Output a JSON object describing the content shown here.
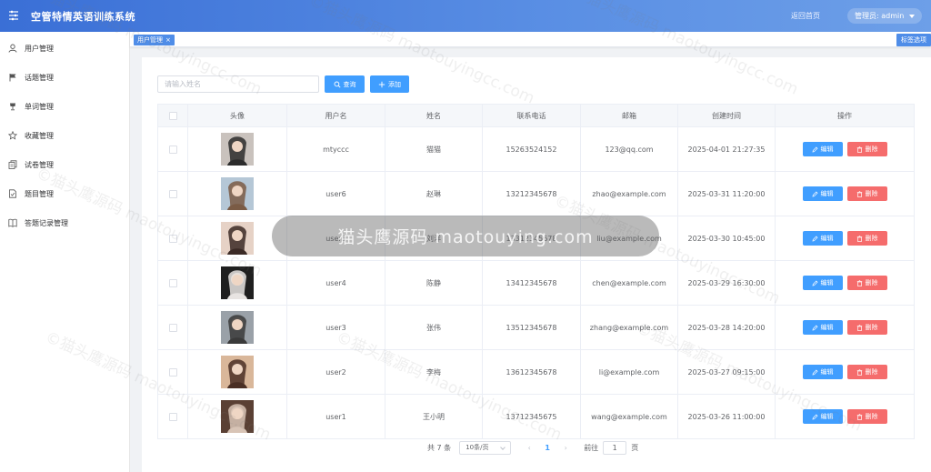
{
  "header": {
    "title": "空管特情英语训练系统",
    "return_home": "返回首页",
    "user_label": "管理员: admin"
  },
  "sidebar": {
    "items": [
      {
        "label": "用户管理",
        "icon": "user-icon"
      },
      {
        "label": "话题管理",
        "icon": "flag-icon"
      },
      {
        "label": "单词管理",
        "icon": "cup-icon"
      },
      {
        "label": "收藏管理",
        "icon": "star-icon"
      },
      {
        "label": "试卷管理",
        "icon": "document-copy-icon"
      },
      {
        "label": "题目管理",
        "icon": "document-checked-icon"
      },
      {
        "label": "答题记录管理",
        "icon": "notebook-icon"
      }
    ]
  },
  "tabs": {
    "active": "用户管理",
    "options_label": "标签选项"
  },
  "toolbar": {
    "search_placeholder": "请输入姓名",
    "query_label": "查询",
    "add_label": "添加"
  },
  "table": {
    "headers": [
      "头像",
      "用户名",
      "姓名",
      "联系电话",
      "邮箱",
      "创建时间",
      "操作"
    ],
    "edit_label": "编辑",
    "delete_label": "删除",
    "rows": [
      {
        "username": "mtyccc",
        "name": "猫猫",
        "phone": "15263524152",
        "email": "123@qq.com",
        "created": "2025-04-01 21:27:35"
      },
      {
        "username": "user6",
        "name": "赵琳",
        "phone": "13212345678",
        "email": "zhao@example.com",
        "created": "2025-03-31 11:20:00"
      },
      {
        "username": "user5",
        "name": "刘洋",
        "phone": "13312345678",
        "email": "liu@example.com",
        "created": "2025-03-30 10:45:00"
      },
      {
        "username": "user4",
        "name": "陈静",
        "phone": "13412345678",
        "email": "chen@example.com",
        "created": "2025-03-29 16:30:00"
      },
      {
        "username": "user3",
        "name": "张伟",
        "phone": "13512345678",
        "email": "zhang@example.com",
        "created": "2025-03-28 14:20:00"
      },
      {
        "username": "user2",
        "name": "李梅",
        "phone": "13612345678",
        "email": "li@example.com",
        "created": "2025-03-27 09:15:00"
      },
      {
        "username": "user1",
        "name": "王小明",
        "phone": "13712345675",
        "email": "wang@example.com",
        "created": "2025-03-26 11:00:00"
      }
    ]
  },
  "pagination": {
    "total": "共 7 条",
    "page_size": "10条/页",
    "current_page": "1",
    "goto_label": "前往",
    "goto_value": "1",
    "page_suffix": "页"
  },
  "watermark": {
    "center": "猫头鹰源码 maotouying.com",
    "repeat": "©猫头鹰源码 maotouyingcc.com"
  },
  "colors": {
    "primary": "#409eff",
    "danger": "#f56c6c",
    "header_start": "#3a6fd6",
    "header_end": "#6d9fe8"
  }
}
